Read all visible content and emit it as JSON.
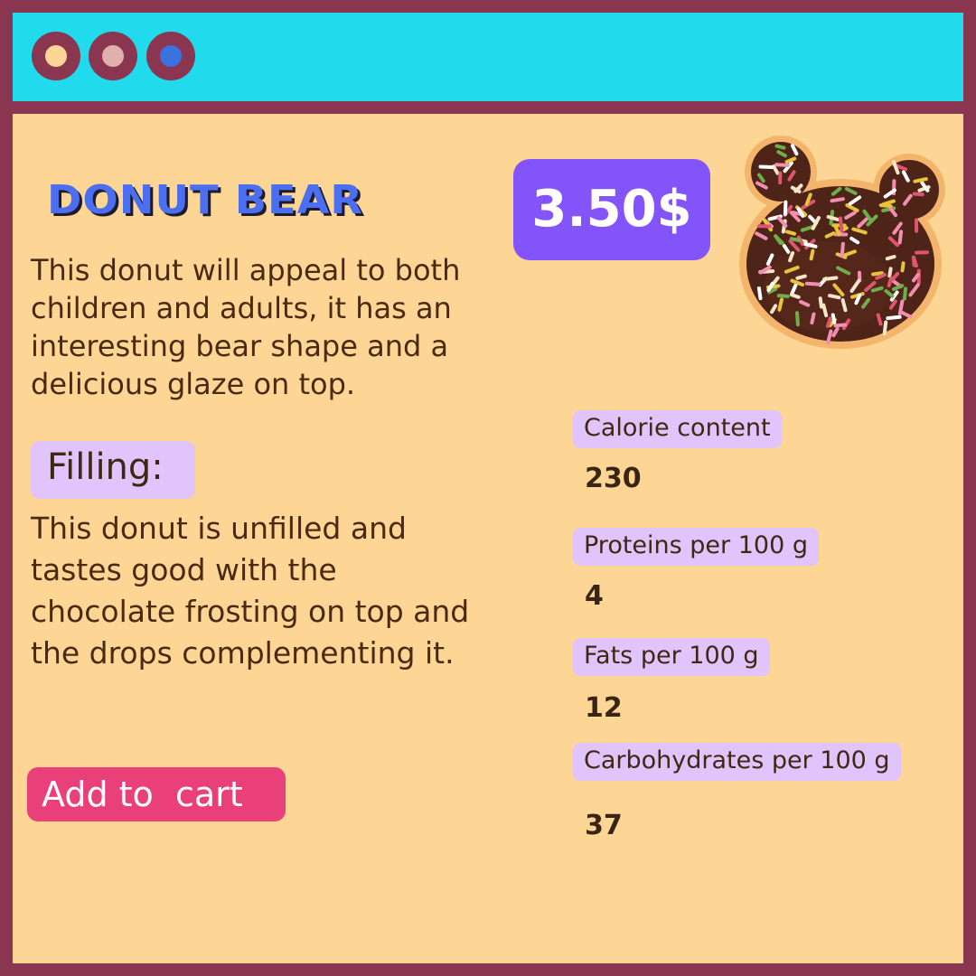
{
  "window": {
    "controls": [
      "close-dot",
      "minimize-dot",
      "maximize-dot"
    ]
  },
  "product": {
    "title": "Donut bear",
    "description": "This donut will appeal to both children and adults, it has an interesting bear shape and a delicious glaze on top.",
    "price": "3.50$",
    "filling_label": "Filling:",
    "filling_text": "This donut is unfilled and tastes good with the chocolate frosting on top and the drops complementing it.",
    "add_to_cart_label": "Add to  cart"
  },
  "nutrition": [
    {
      "label": "Calorie content",
      "value": "230"
    },
    {
      "label": "Proteins per 100 g",
      "value": "4"
    },
    {
      "label": "Fats per 100 g",
      "value": "12"
    },
    {
      "label": "Carbohydrates per 100 g",
      "value": "37"
    }
  ],
  "colors": {
    "titlebar": "#21daec",
    "frame": "#8b3650",
    "background": "#fdd595",
    "price_badge": "#8454fb",
    "cart_button": "#ea407a",
    "label_chip": "#e1c4fb",
    "title_text": "#4b6ff0"
  },
  "icons": {
    "product_image": "bear-donut-illustration"
  }
}
